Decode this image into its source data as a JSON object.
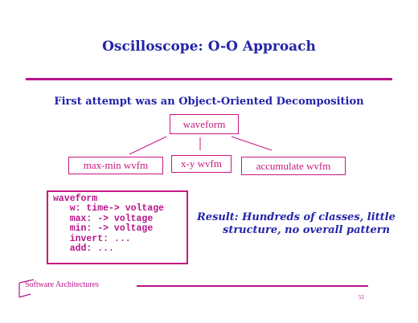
{
  "title": "Oscilloscope: O-O Approach",
  "subtitle": "First attempt was an Object-Oriented Decomposition",
  "diagram": {
    "root": "waveform",
    "children": [
      "max-min wvfm",
      "x-y wvfm",
      "accumulate wvfm"
    ]
  },
  "code": [
    "waveform",
    "   w: time-> voltage",
    "   max: -> voltage",
    "   min: -> voltage",
    "   invert: ...",
    "   add: ..."
  ],
  "result": {
    "line1": "Result: Hundreds of classes, little",
    "line2": "structure, no overall pattern"
  },
  "footer": {
    "label": "Software Architectures",
    "page": "52"
  },
  "colors": {
    "title_blue": "#2424a8",
    "accent_magenta": "#b8138a",
    "box_border": "#c8187f"
  }
}
